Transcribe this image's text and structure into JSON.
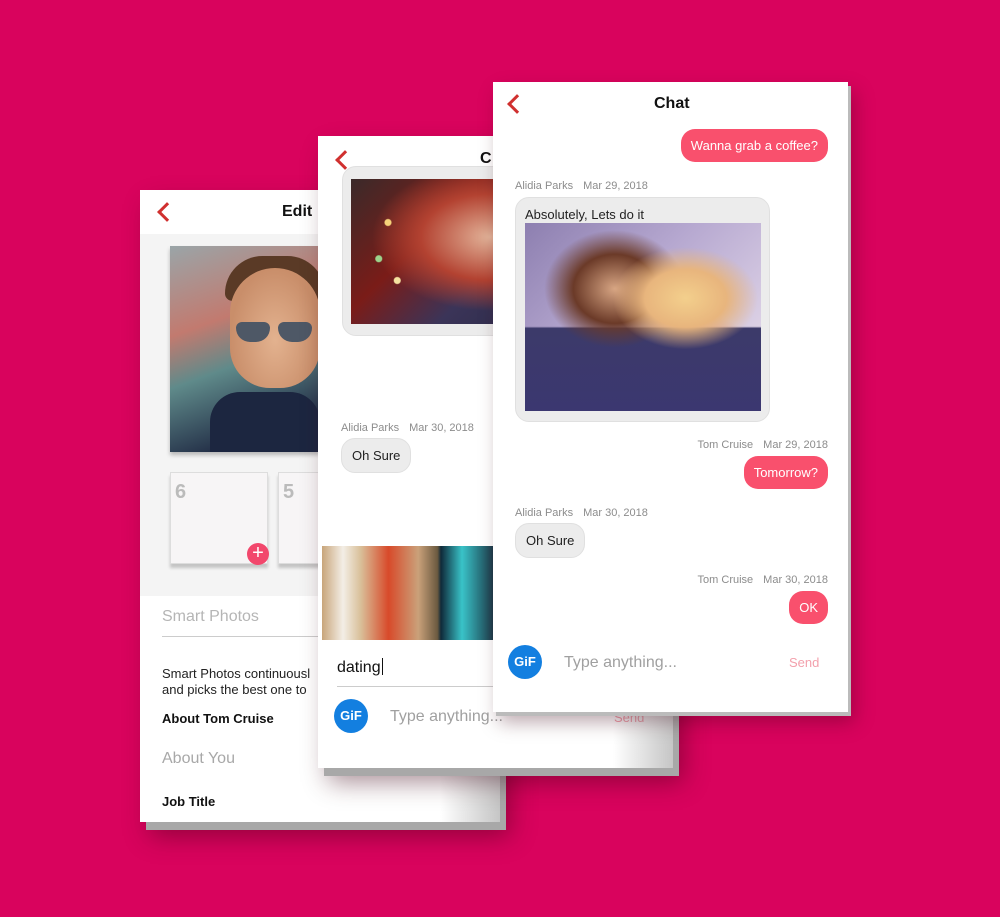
{
  "background_color": "#d9035d",
  "accent_color": "#f9506d",
  "edit_screen": {
    "title": "Edit",
    "back_icon": "chevron-left-icon",
    "photo_slots": [
      {
        "number": "6",
        "add_icon": "+"
      },
      {
        "number": "5"
      }
    ],
    "smart_photos_label": "Smart Photos",
    "smart_photos_description_line1": "Smart Photos continuousl",
    "smart_photos_description_line2": "and picks the best one to",
    "about_heading": "About Tom Cruise",
    "about_placeholder": "About You",
    "job_title_label": "Job Title"
  },
  "middle_chat_screen": {
    "title": "C",
    "back_icon": "chevron-left-icon",
    "messages": [
      {
        "sender": "Alidia Parks",
        "date": "Mar 30, 2018",
        "text": "Oh Sure"
      }
    ],
    "gif_search_value": "dating",
    "gif_button_label": "GiF",
    "input_placeholder": "Type anything...",
    "send_label": "Send"
  },
  "front_chat_screen": {
    "title": "Chat",
    "back_icon": "chevron-left-icon",
    "messages": [
      {
        "direction": "out",
        "text": "Wanna grab a coffee?"
      },
      {
        "direction": "in",
        "sender": "Alidia Parks",
        "date": "Mar 29, 2018",
        "text": "Absolutely, Lets do it",
        "has_gif": true
      },
      {
        "direction": "out",
        "sender": "Tom Cruise",
        "date": "Mar 29, 2018",
        "text": "Tomorrow?"
      },
      {
        "direction": "in",
        "sender": "Alidia Parks",
        "date": "Mar 30, 2018",
        "text": "Oh Sure"
      },
      {
        "direction": "out",
        "sender": "Tom Cruise",
        "date": "Mar 30, 2018",
        "text": "OK"
      }
    ],
    "gif_button_label": "GiF",
    "input_placeholder": "Type anything...",
    "send_label": "Send"
  }
}
